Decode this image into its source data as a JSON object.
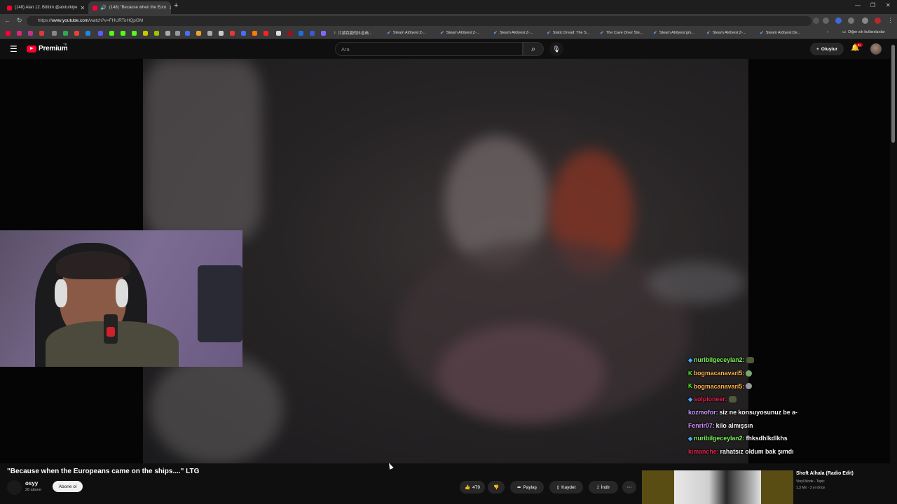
{
  "browser": {
    "tabs": [
      {
        "label": "(148) Alan 12. Bölüm @atvturkiye"
      },
      {
        "label": "(148) \"Because when the Euro"
      }
    ],
    "new_tab_icon": "plus-icon",
    "url_prefix": "https://",
    "url_host": "www.youtube.com",
    "url_path": "/watch?v=FHURToHQpGM",
    "bookmarks": [
      {
        "label": "江湖百變的抖音商..."
      },
      {
        "label": "Steam Atölyesi:Z-..."
      },
      {
        "label": "Steam Atölyesi:Z-..."
      },
      {
        "label": "Steam Atölyesi:Z-..."
      },
      {
        "label": "Static Dread: The S..."
      },
      {
        "label": "The Cave Diver Ste..."
      },
      {
        "label": "Steam Atölyesi:gm..."
      },
      {
        "label": "Steam Atölyesi:Z-..."
      },
      {
        "label": "Steam Atölyesi:De..."
      }
    ],
    "other_bookmarks_label": "Diğer sık kullanılanlar"
  },
  "header": {
    "logo_text": "Premium",
    "logo_region": "TR",
    "search_placeholder": "Ara",
    "create_label": "Oluştur",
    "notification_count": "9+"
  },
  "chat": [
    {
      "user": "nuribilgeceylan2:",
      "user_color": "#7cf05a",
      "badge": "cube-icon",
      "badge_color": "#4aa8ff",
      "message": "",
      "emote_color": "#4e5a3a"
    },
    {
      "user": "bogmacanavari5:",
      "user_color": "#ffb347",
      "badge": "kick-k-icon",
      "badge_color": "#53fc18",
      "message": "",
      "emote_color": "#7aa86a"
    },
    {
      "user": "bogmacanavari5:",
      "user_color": "#ffb347",
      "badge": "kick-k-icon",
      "badge_color": "#53fc18",
      "message": "",
      "emote_color": "#9a9a9a"
    },
    {
      "user": "solpioneer:",
      "user_color": "#e0204a",
      "badge": "cube-icon",
      "badge_color": "#4aa8ff",
      "message": "",
      "emote_color": "#4e5a3a"
    },
    {
      "user": "kozmofor:",
      "user_color": "#c49bff",
      "badge": "",
      "badge_color": "",
      "message": "siz ne konsuyosunuz be a-",
      "emote_color": ""
    },
    {
      "user": "Fenrir07:",
      "user_color": "#d48cff",
      "badge": "",
      "badge_color": "",
      "message": "kilo almışsın",
      "emote_color": ""
    },
    {
      "user": "nuribilgeceylan2:",
      "user_color": "#7cf05a",
      "badge": "cube-icon",
      "badge_color": "#4aa8ff",
      "message": "fhksdhlkdlkhs",
      "emote_color": ""
    },
    {
      "user": "kimanche:",
      "user_color": "#e0204a",
      "badge": "",
      "badge_color": "",
      "message": "rahatsız oldum bak şımdı",
      "emote_color": ""
    }
  ],
  "video": {
    "title": "\"Because when the Europeans came on the ships....\" LTG",
    "channel_name": "osyy",
    "subscribers": "28 abone",
    "subscribe_label": "Abone ol",
    "like_count": "479",
    "share_label": "Paylaş",
    "save_label": "Kaydet",
    "download_label": "İndir"
  },
  "recommendation": {
    "title": "Shoft Alhala (Radio Edit)",
    "channel": "Vinyl Mode - Topic",
    "meta": "1,3 Mn · 3 yıl önce"
  },
  "colors": {
    "brand": "#ff0033",
    "background": "#0f0f0f"
  }
}
